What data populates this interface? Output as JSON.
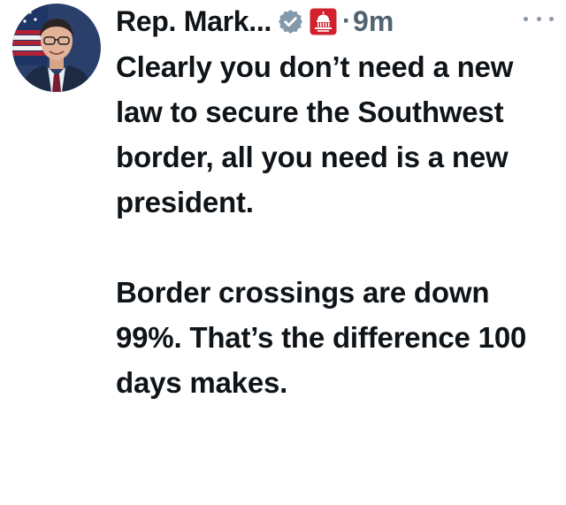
{
  "tweet": {
    "author": {
      "display_name": "Rep. Mark...",
      "verified_icon": "verified-badge-icon",
      "affiliation_icon": "capitol-gop-affiliate-icon",
      "avatar": "profile-photo"
    },
    "separator": "·",
    "timestamp": "9m",
    "more_icon": "more-options-icon",
    "paragraphs": [
      "Clearly you don’t need a new law to secure the Southwest border, all you need is a new president.",
      "Border crossings are down 99%. That’s the difference 100 days makes."
    ]
  },
  "colors": {
    "text": "#0f1419",
    "secondary_text": "#536471",
    "verified_badge": "#829aab",
    "affiliate_badge": "#d0212d"
  }
}
